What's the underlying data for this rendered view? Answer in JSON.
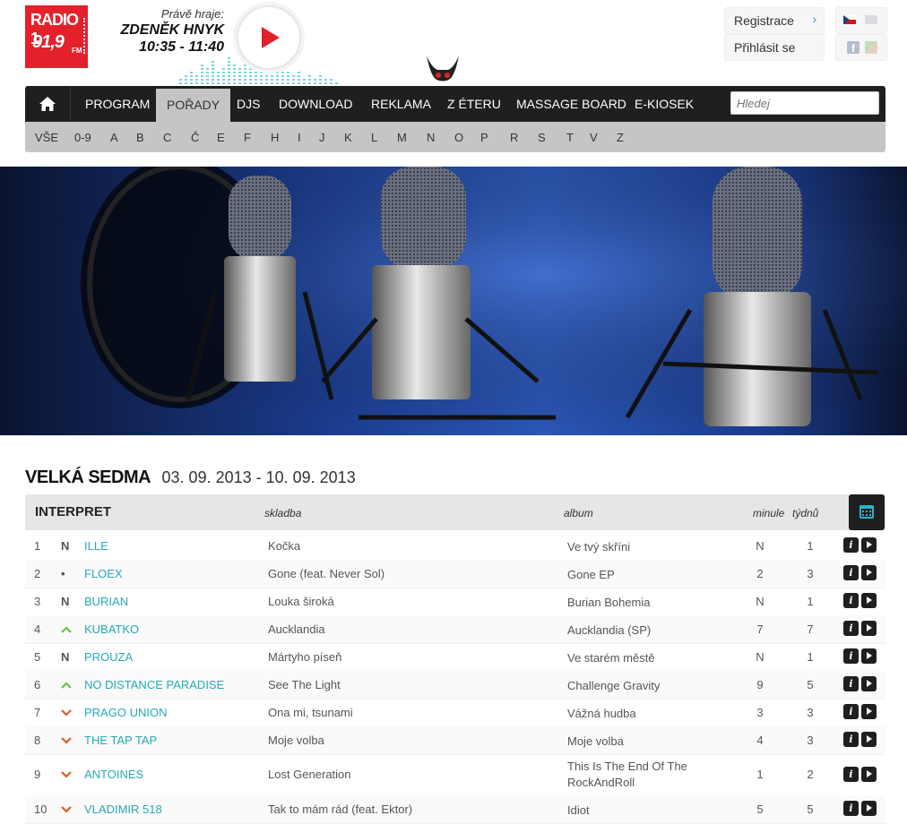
{
  "header": {
    "logo_line1": "RADIO 1",
    "logo_line2": "91,9",
    "logo_fm": "FM",
    "now_playing_label": "Právě hraje:",
    "host": "ZDENĚK HNYK",
    "time": "10:35 - 11:40",
    "register": "Registrace",
    "login": "Přihlásit se"
  },
  "nav": {
    "items": [
      "PROGRAM",
      "POŘADY",
      "DJS",
      "DOWNLOAD",
      "REKLAMA",
      "Z ÉTERU",
      "MASSAGE BOARD",
      "E-KIOSEK"
    ],
    "active": "POŘADY",
    "search_placeholder": "Hledej"
  },
  "alphabet": [
    "VŠE",
    "0-9",
    "A",
    "B",
    "C",
    "Č",
    "E",
    "F",
    "H",
    "I",
    "J",
    "K",
    "L",
    "M",
    "N",
    "O",
    "P",
    "R",
    "S",
    "T",
    "V",
    "Z"
  ],
  "chart": {
    "title": "VELKÁ SEDMA",
    "date_range": "03. 09. 2013 - 10. 09. 2013",
    "columns": {
      "artist": "INTERPRET",
      "song": "skladba",
      "album": "album",
      "last": "minule",
      "weeks": "týdnů"
    },
    "rows": [
      {
        "rank": "1",
        "trend": "N",
        "artist": "ILLE",
        "song": "Kočka",
        "album": "Ve tvý skříni",
        "last": "N",
        "weeks": "1"
      },
      {
        "rank": "2",
        "trend": "•",
        "artist": "FLOEX",
        "song": "Gone (feat. Never Sol)",
        "album": "Gone EP",
        "last": "2",
        "weeks": "3"
      },
      {
        "rank": "3",
        "trend": "N",
        "artist": "BURIAN",
        "song": "Louka široká",
        "album": "Burian Bohemia",
        "last": "N",
        "weeks": "1"
      },
      {
        "rank": "4",
        "trend": "^",
        "artist": "KUBATKO",
        "song": "Aucklandia",
        "album": "Aucklandia (SP)",
        "last": "7",
        "weeks": "7"
      },
      {
        "rank": "5",
        "trend": "N",
        "artist": "PROUZA",
        "song": "Mártyho píseň",
        "album": "Ve starém městě",
        "last": "N",
        "weeks": "1"
      },
      {
        "rank": "6",
        "trend": "^",
        "artist": "NO DISTANCE PARADISE",
        "song": "See The Light",
        "album": "Challenge Gravity",
        "last": "9",
        "weeks": "5"
      },
      {
        "rank": "7",
        "trend": "v",
        "artist": "PRAGO UNION",
        "song": "Ona mi, tsunami",
        "album": "Vážná hudba",
        "last": "3",
        "weeks": "3"
      },
      {
        "rank": "8",
        "trend": "v",
        "artist": "THE TAP TAP",
        "song": "Moje volba",
        "album": "Moje volba",
        "last": "4",
        "weeks": "3"
      },
      {
        "rank": "9",
        "trend": "v",
        "artist": "ANTOINES",
        "song": "Lost Generation",
        "album": "This Is The End Of The RockAndRoll",
        "last": "1",
        "weeks": "2"
      },
      {
        "rank": "10",
        "trend": "v",
        "artist": "VLADIMIR 518",
        "song": "Tak to mám rád (feat. Ektor)",
        "album": "Idiot",
        "last": "5",
        "weeks": "5"
      }
    ]
  }
}
